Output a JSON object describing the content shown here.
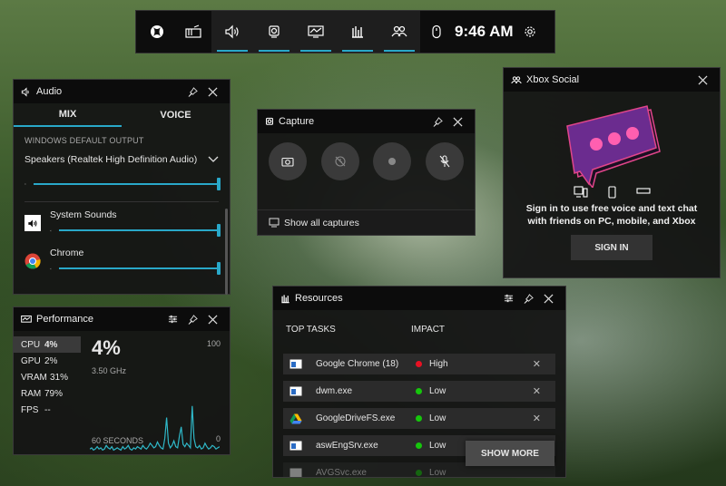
{
  "topbar": {
    "time": "9:46 AM",
    "icons": [
      "xbox-icon",
      "widget-menu-icon",
      "audio-icon",
      "capture-icon",
      "performance-icon",
      "resources-icon",
      "social-icon",
      "mouse-icon",
      "settings-icon"
    ]
  },
  "audio": {
    "title": "Audio",
    "tabs": [
      "MIX",
      "VOICE"
    ],
    "default_output_label": "WINDOWS DEFAULT OUTPUT",
    "device": "Speakers (Realtek High Definition Audio)",
    "master_level": 1.0,
    "apps": [
      {
        "name": "System Sounds",
        "level": 1.0
      },
      {
        "name": "Chrome",
        "level": 1.0
      }
    ]
  },
  "capture": {
    "title": "Capture",
    "show_all": "Show all captures"
  },
  "social": {
    "title": "Xbox Social",
    "message": "Sign in to use free voice and text chat with friends on PC, mobile, and Xbox",
    "signin": "SIGN IN",
    "colors": {
      "bubble": "#6b2c8f",
      "outline": "#e0458a",
      "dots": "#ff5fb0"
    }
  },
  "performance": {
    "title": "Performance",
    "stats": [
      {
        "label": "CPU",
        "value": "4%"
      },
      {
        "label": "GPU",
        "value": "2%"
      },
      {
        "label": "VRAM",
        "value": "31%"
      },
      {
        "label": "RAM",
        "value": "79%"
      },
      {
        "label": "FPS",
        "value": "--"
      }
    ],
    "big_value": "4%",
    "freq": "3.50 GHz",
    "max_label": "100",
    "min_label": "0",
    "time_label": "60 SECONDS",
    "graph": [
      3,
      4,
      2,
      3,
      5,
      3,
      4,
      2,
      3,
      6,
      4,
      3,
      5,
      2,
      3,
      4,
      3,
      2,
      5,
      3,
      4,
      6,
      3,
      2,
      4,
      3,
      5,
      4,
      3,
      6,
      4,
      3,
      5,
      8,
      6,
      4,
      5,
      9,
      6,
      4,
      3,
      12,
      30,
      8,
      4,
      6,
      10,
      5,
      4,
      14,
      22,
      7,
      5,
      8,
      6,
      4,
      40,
      12,
      5,
      4,
      6,
      3,
      4,
      8,
      5,
      3,
      4,
      6,
      5,
      3,
      4,
      5
    ]
  },
  "resources": {
    "title": "Resources",
    "col_task": "TOP TASKS",
    "col_impact": "IMPACT",
    "rows": [
      {
        "name": "Google Chrome (18)",
        "impact": "High",
        "color": "#e81123"
      },
      {
        "name": "dwm.exe",
        "impact": "Low",
        "color": "#16c60c"
      },
      {
        "name": "GoogleDriveFS.exe",
        "impact": "Low",
        "color": "#16c60c"
      },
      {
        "name": "aswEngSrv.exe",
        "impact": "Low",
        "color": "#16c60c"
      },
      {
        "name": "AVGSvc.exe",
        "impact": "Low",
        "color": "#16c60c"
      }
    ],
    "show_more": "SHOW MORE"
  }
}
